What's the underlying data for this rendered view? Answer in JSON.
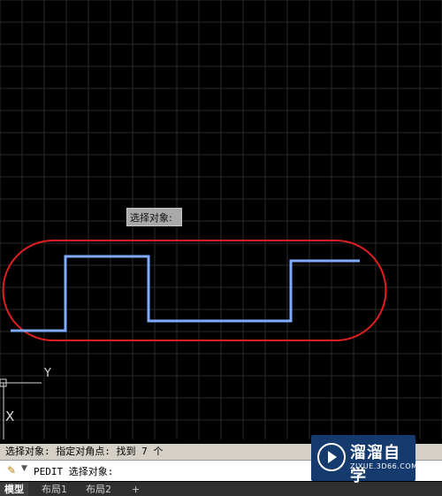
{
  "drawing": {
    "tooltip": "选择对象:",
    "ucs_y_label": "Y",
    "ucs_x_label": "X",
    "colors": {
      "background": "#000000",
      "grid": "#2a2a2a",
      "polyline": "#7eaaff",
      "selection_outline": "#e02020"
    }
  },
  "command": {
    "history": "选择对象: 指定对角点: 找到 7 个",
    "prompt": "PEDIT 选择对象:",
    "icon": "pencil-icon",
    "dropdown_icon": "caret-down-icon"
  },
  "tabs": [
    "模型",
    "布局1",
    "布局2",
    "+"
  ],
  "active_tab": "模型",
  "watermark": {
    "title": "溜溜自学",
    "url": "ZIXUE.3D66.COM",
    "icon": "play-logo-icon"
  }
}
